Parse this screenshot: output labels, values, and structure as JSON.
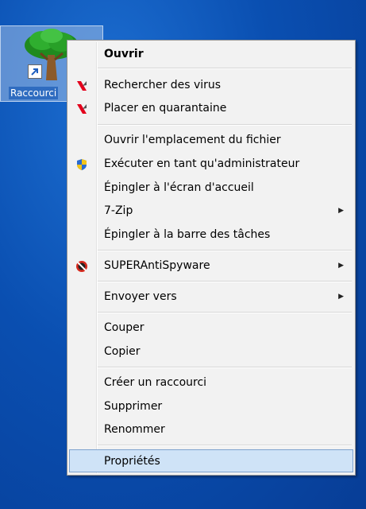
{
  "desktop": {
    "icon_label": "Raccourci"
  },
  "menu": {
    "items": [
      {
        "label": "Ouvrir"
      },
      {
        "label": "Rechercher des virus"
      },
      {
        "label": "Placer en quarantaine"
      },
      {
        "label": "Ouvrir l'emplacement du fichier"
      },
      {
        "label": "Exécuter en tant qu'administrateur"
      },
      {
        "label": "Épingler à l'écran d'accueil"
      },
      {
        "label": "7-Zip"
      },
      {
        "label": "Épingler à la barre des tâches"
      },
      {
        "label": "SUPERAntiSpyware"
      },
      {
        "label": "Envoyer vers"
      },
      {
        "label": "Couper"
      },
      {
        "label": "Copier"
      },
      {
        "label": "Créer un raccourci"
      },
      {
        "label": "Supprimer"
      },
      {
        "label": "Renommer"
      },
      {
        "label": "Propriétés"
      }
    ],
    "submenu_arrow": "▶"
  },
  "colors": {
    "desktop_bg": "#0a4fb1",
    "menu_bg": "#f2f2f2",
    "hover_bg": "#cfe3f7",
    "kaspersky_red": "#e3001b"
  }
}
